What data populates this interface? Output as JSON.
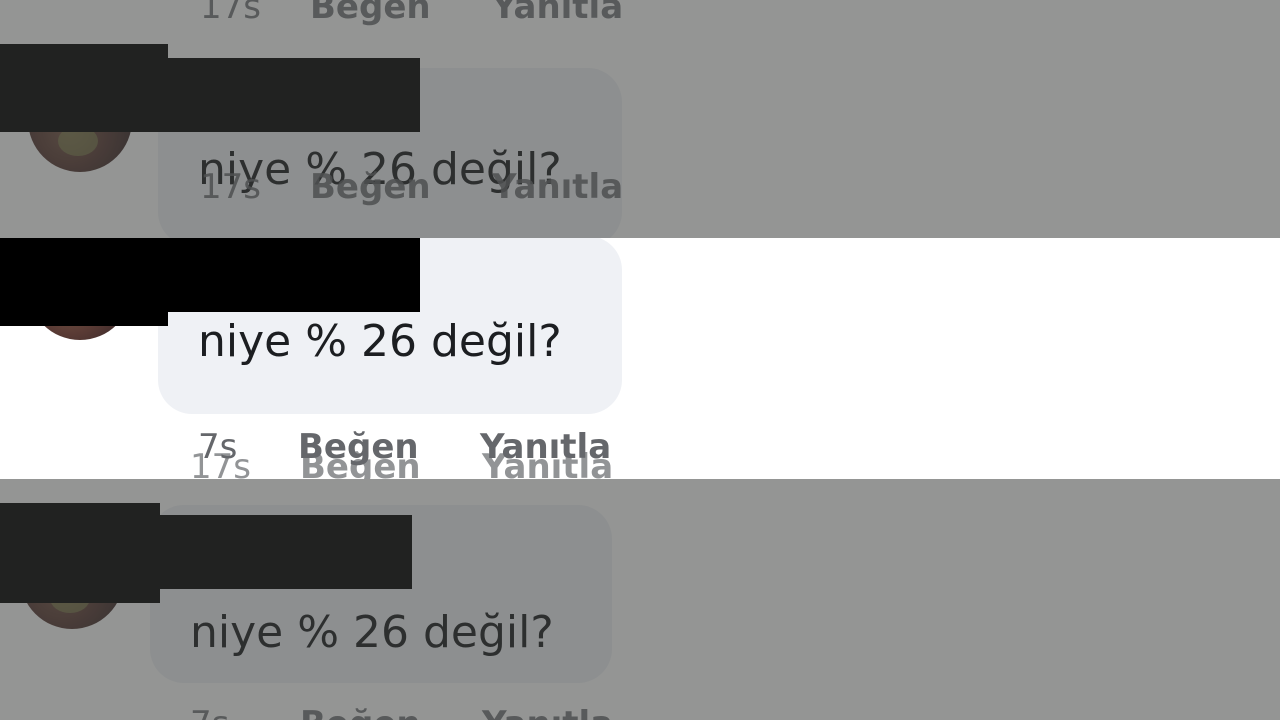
{
  "comment": {
    "text": "niye % 26 değil?",
    "time": "7s",
    "like_label": "Beğen",
    "reply_label": "Yanıtla"
  },
  "ghost_meta": {
    "time": "17s",
    "like_label": "Beğen",
    "reply_label": "Yanıtla"
  },
  "colors": {
    "bubble": "#eff1f5",
    "text": "#1c1e21",
    "meta": "#65676b",
    "overlay": "#919291",
    "redaction": "#000000"
  }
}
